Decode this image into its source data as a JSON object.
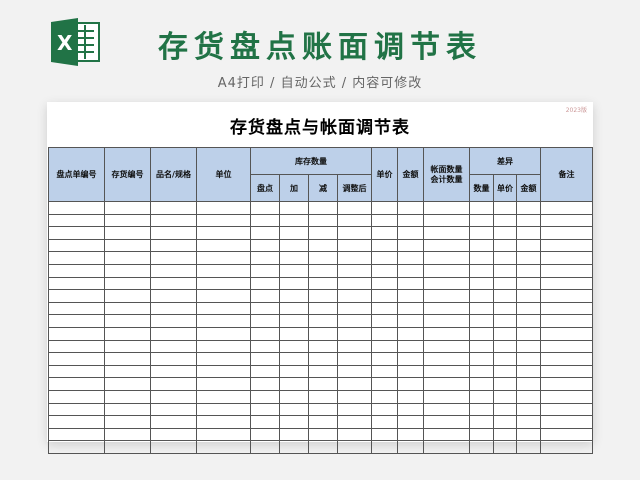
{
  "header": {
    "app_icon": "excel-icon",
    "title": "存货盘点账面调节表",
    "subtitle": "A4打印 / 自动公式 / 内容可修改"
  },
  "sheet": {
    "stamp": "2023版",
    "title": "存货盘点与帐面调节表",
    "columns": {
      "count_no": "盘点单编号",
      "stock_no": "存货编号",
      "name_spec": "品名/规格",
      "unit": "单位",
      "stock_qty": "库存数量",
      "count": "盘点",
      "add": "加",
      "minus": "减",
      "adjusted": "调整后",
      "unit_price": "单价",
      "amount": "金额",
      "book_qty_line1": "帐面数量",
      "book_qty_line2": "会计数量",
      "diff": "差异",
      "diff_qty": "数量",
      "diff_price": "单价",
      "diff_amount": "金额",
      "remarks": "备注"
    },
    "empty_rows": 20
  },
  "colors": {
    "brand_green": "#217346",
    "header_fill": "#bdd0e9"
  }
}
